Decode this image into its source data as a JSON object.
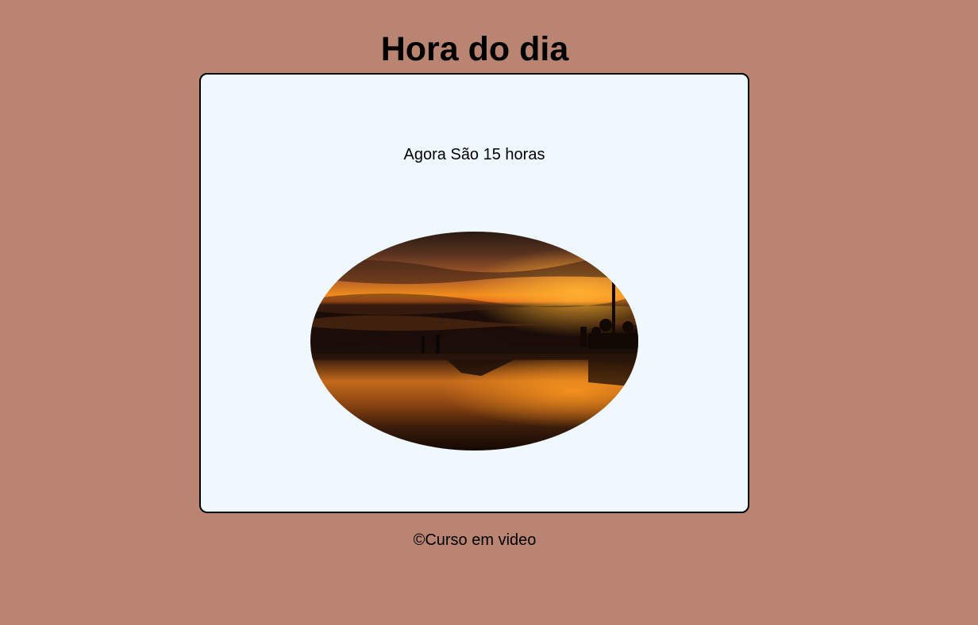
{
  "header": {
    "title": "Hora do dia"
  },
  "card": {
    "message": "Agora São 15 horas",
    "image_icon": "sunset-beach-photo"
  },
  "footer": {
    "text": "©Curso em video"
  },
  "colors": {
    "page_background": "#b98572",
    "card_background": "#f0f8ff",
    "card_border": "#000000"
  }
}
